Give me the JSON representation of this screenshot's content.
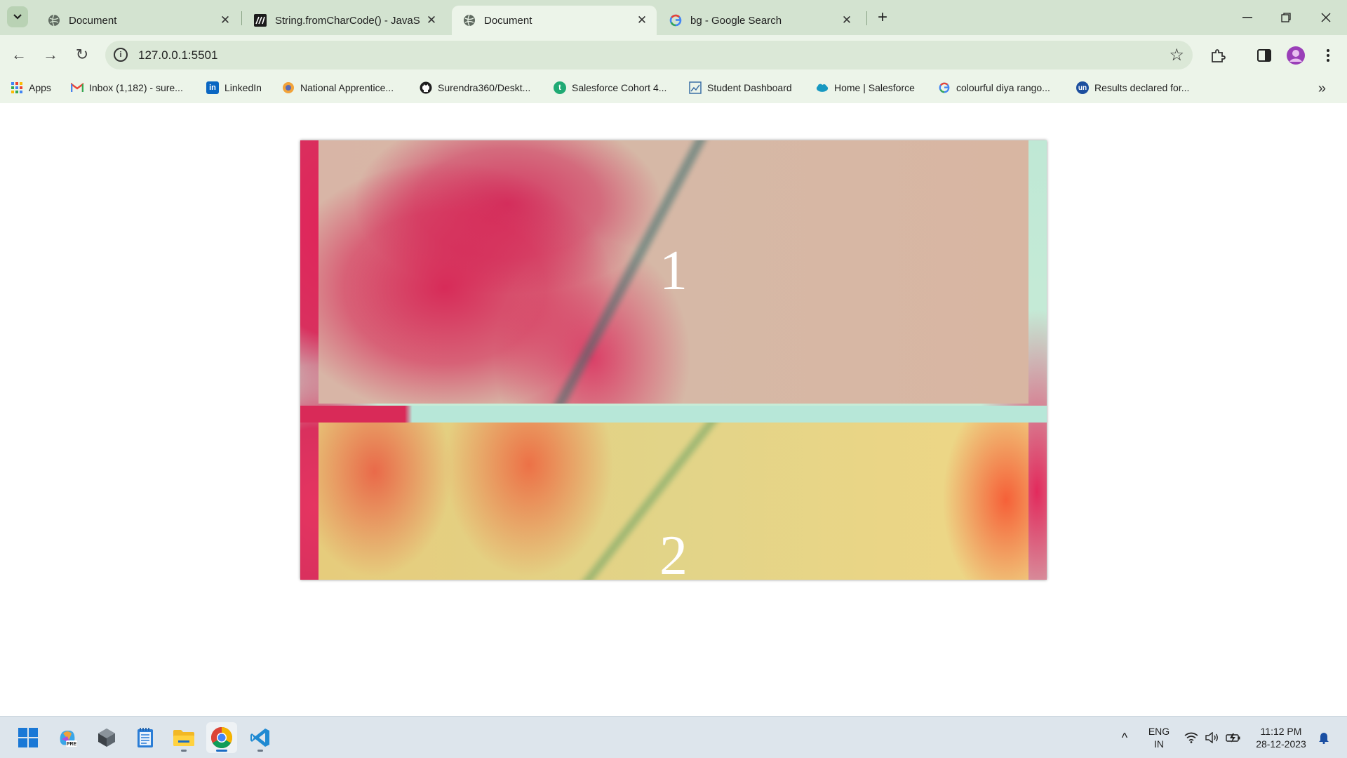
{
  "browser": {
    "tabs": [
      {
        "title": "Document",
        "favicon": "globe-icon",
        "active": false
      },
      {
        "title": "String.fromCharCode() - JavaScript",
        "favicon": "mdn-icon",
        "active": false
      },
      {
        "title": "Document",
        "favicon": "globe-icon",
        "active": true
      },
      {
        "title": "bg - Google Search",
        "favicon": "google-icon",
        "active": false
      }
    ],
    "close_glyph": "✕",
    "new_tab_glyph": "+",
    "window_controls": {
      "minimize": "—",
      "restore": "❐",
      "close": "✕"
    }
  },
  "toolbar": {
    "back": "←",
    "forward": "→",
    "reload": "↻",
    "info": "i",
    "url": "127.0.0.1:5501",
    "star": "☆"
  },
  "bookmarks": {
    "items": [
      {
        "label": "Apps",
        "icon": "apps-grid-icon"
      },
      {
        "label": "Inbox (1,182) - sure...",
        "icon": "gmail-icon"
      },
      {
        "label": "LinkedIn",
        "icon": "linkedin-icon"
      },
      {
        "label": "National Apprentice...",
        "icon": "apprentice-icon"
      },
      {
        "label": "Surendra360/Deskt...",
        "icon": "github-icon"
      },
      {
        "label": "Salesforce Cohort 4...",
        "icon": "trailhead-icon"
      },
      {
        "label": "Student Dashboard",
        "icon": "dashboard-icon"
      },
      {
        "label": "Home | Salesforce",
        "icon": "salesforce-icon"
      },
      {
        "label": "colourful diya rango...",
        "icon": "google-icon"
      },
      {
        "label": "Results declared for...",
        "icon": "unstop-icon"
      }
    ],
    "more": "»"
  },
  "page": {
    "box1_text": "1",
    "box2_text": "2"
  },
  "taskbar": {
    "apps": [
      "windows-start-icon",
      "copilot-pre-icon",
      "cube-app-icon",
      "notepad-icon",
      "file-explorer-icon",
      "chrome-icon",
      "vscode-icon"
    ],
    "language": "ENG",
    "region": "IN",
    "time": "11:12 PM",
    "date": "28-12-2023",
    "chevron": "^"
  },
  "colors": {
    "tab_strip": "#d3e3d0",
    "toolbar": "#ecf4e9",
    "accent_blue": "#1a6cc4"
  }
}
